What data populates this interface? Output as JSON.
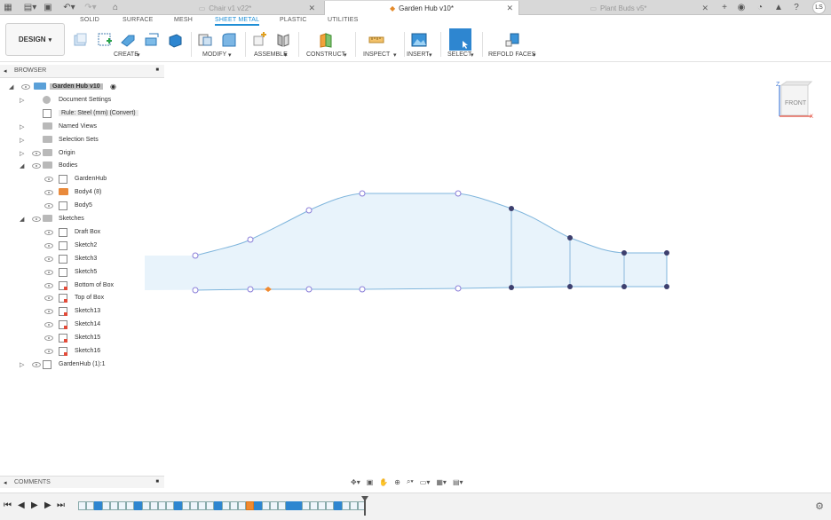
{
  "tabs": {
    "documents": [
      {
        "label": "Chair v1 v22*",
        "active": false
      },
      {
        "label": "Garden Hub v10*",
        "active": true
      },
      {
        "label": "Plant Buds v5*",
        "active": false
      }
    ],
    "user_initials": "LS"
  },
  "ribbon": {
    "workspace": "DESIGN",
    "workspace_caret": "▾",
    "tabs": [
      "SOLID",
      "SURFACE",
      "MESH",
      "SHEET METAL",
      "PLASTIC",
      "UTILITIES"
    ],
    "active_tab": "SHEET METAL",
    "groups": [
      "CREATE",
      "MODIFY",
      "ASSEMBLE",
      "CONSTRUCT",
      "INSPECT",
      "INSERT",
      "SELECT",
      "REFOLD FACES"
    ],
    "accent": "#1f8fd6"
  },
  "browser": {
    "title": "BROWSER",
    "items": [
      {
        "label": "Garden Hub v10",
        "level": 0,
        "expand": "open",
        "icon": "component-icon",
        "eye": true
      },
      {
        "label": "Document Settings",
        "level": 1,
        "expand": "closed",
        "icon": "gear-icon",
        "eye": false
      },
      {
        "label": "Rule: Steel (mm) (Convert)",
        "level": 1,
        "expand": "none",
        "icon": "rule-icon",
        "eye": false
      },
      {
        "label": "Named Views",
        "level": 1,
        "expand": "closed",
        "icon": "folder-icon",
        "eye": false
      },
      {
        "label": "Selection Sets",
        "level": 1,
        "expand": "closed",
        "icon": "folder-icon",
        "eye": false
      },
      {
        "label": "Origin",
        "level": 1,
        "expand": "closed",
        "icon": "folder-icon",
        "eye": true
      },
      {
        "label": "Bodies",
        "level": 1,
        "expand": "open",
        "icon": "folder-icon",
        "eye": true
      },
      {
        "label": "GardenHub",
        "level": 2,
        "expand": "none",
        "icon": "body-icon",
        "eye": true
      },
      {
        "label": "Body4 (8)",
        "level": 2,
        "expand": "none",
        "icon": "body-orange-icon",
        "eye": true
      },
      {
        "label": "Body5",
        "level": 2,
        "expand": "none",
        "icon": "body-icon",
        "eye": true
      },
      {
        "label": "Sketches",
        "level": 1,
        "expand": "open",
        "icon": "folder-icon",
        "eye": true
      },
      {
        "label": "Draft Box",
        "level": 2,
        "expand": "none",
        "icon": "sketch-icon",
        "eye": true
      },
      {
        "label": "Sketch2",
        "level": 2,
        "expand": "none",
        "icon": "sketch-icon",
        "eye": true
      },
      {
        "label": "Sketch3",
        "level": 2,
        "expand": "none",
        "icon": "sketch-icon",
        "eye": true
      },
      {
        "label": "Sketch5",
        "level": 2,
        "expand": "none",
        "icon": "sketch-icon",
        "eye": true
      },
      {
        "label": "Bottom of Box",
        "level": 2,
        "expand": "none",
        "icon": "sketch-red-icon",
        "eye": true
      },
      {
        "label": "Top of Box",
        "level": 2,
        "expand": "none",
        "icon": "sketch-red-icon",
        "eye": true
      },
      {
        "label": "Sketch13",
        "level": 2,
        "expand": "none",
        "icon": "sketch-red-icon",
        "eye": true
      },
      {
        "label": "Sketch14",
        "level": 2,
        "expand": "none",
        "icon": "sketch-red-icon",
        "eye": true
      },
      {
        "label": "Sketch15",
        "level": 2,
        "expand": "none",
        "icon": "sketch-red-icon",
        "eye": true
      },
      {
        "label": "Sketch16",
        "level": 2,
        "expand": "none",
        "icon": "sketch-red-icon",
        "eye": true
      },
      {
        "label": "GardenHub (1):1",
        "level": 1,
        "expand": "closed",
        "icon": "component-link-icon",
        "eye": true
      }
    ]
  },
  "comments": {
    "title": "COMMENTS"
  },
  "viewcube": {
    "face": "FRONT",
    "axis_z": "Z",
    "axis_x": "X"
  },
  "sketch": {
    "fill": "#e8f3fb",
    "stroke": "#7fb5dc"
  },
  "timeline": {
    "feature_count": 36
  }
}
